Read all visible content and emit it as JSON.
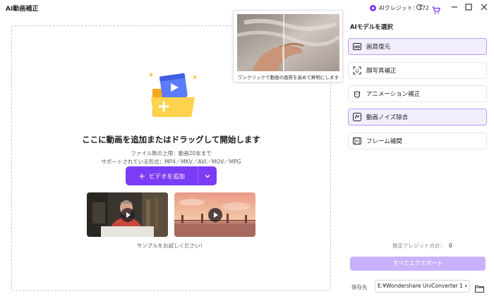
{
  "app": {
    "title": "AI動画補正"
  },
  "titlebar": {
    "credits_label": "AIクレジット：",
    "credits_value": "172"
  },
  "dropzone": {
    "heading": "ここに動画を追加またはドラッグして開始します",
    "limit_text": "ファイル数の上限：動画20本まで",
    "formats_text": "サポートされている形式：MP4／MKV／AVI／MOV／MPG",
    "add_video_label": "ビデオを追加",
    "sample_caption": "サンプルをお試しください！"
  },
  "preview": {
    "caption": "ワンクリックで動画の画質を高めて鮮明にします"
  },
  "panel": {
    "title": "AIモデルを選択",
    "models": [
      {
        "label": "画質復元",
        "icon": "hd-icon",
        "selected": true
      },
      {
        "label": "顔写真補正",
        "icon": "face-scan-icon",
        "selected": false
      },
      {
        "label": "アニメーション補正",
        "icon": "anime-icon",
        "selected": false
      },
      {
        "label": "動画ノイズ除去",
        "icon": "denoise-icon",
        "selected": true
      },
      {
        "label": "フレーム補間",
        "icon": "frame-icon",
        "selected": false
      }
    ],
    "credit_estimate_label": "推定クレジット合計：",
    "credit_estimate_value": "0",
    "export_all_label": "すべてエクスポート",
    "save_label": "保存先",
    "save_path": "E:¥Wondershare UniConverter 1"
  },
  "colors": {
    "accent": "#7b3cf5",
    "accent_disabled": "#c9b2fb",
    "selected_bg": "#f3eefe"
  }
}
